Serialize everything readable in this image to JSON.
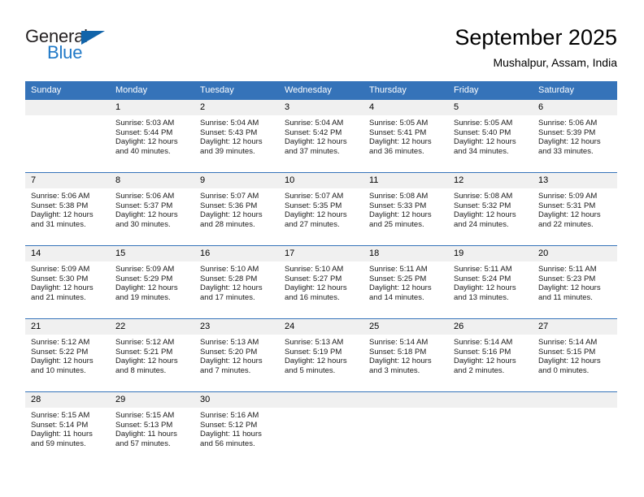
{
  "brand": {
    "name_part1": "General",
    "name_part2": "Blue"
  },
  "header": {
    "title": "September 2025",
    "location": "Mushalpur, Assam, India"
  },
  "colors": {
    "header_blue": "#3573b9",
    "logo_blue": "#2079c7",
    "daynum_band": "#f0f0f0"
  },
  "weekday_headers": [
    "Sunday",
    "Monday",
    "Tuesday",
    "Wednesday",
    "Thursday",
    "Friday",
    "Saturday"
  ],
  "weeks": [
    [
      {
        "day": "",
        "sunrise": "",
        "sunset": "",
        "daylight_line1": "",
        "daylight_line2": "",
        "empty": true
      },
      {
        "day": "1",
        "sunrise": "Sunrise: 5:03 AM",
        "sunset": "Sunset: 5:44 PM",
        "daylight_line1": "Daylight: 12 hours",
        "daylight_line2": "and 40 minutes."
      },
      {
        "day": "2",
        "sunrise": "Sunrise: 5:04 AM",
        "sunset": "Sunset: 5:43 PM",
        "daylight_line1": "Daylight: 12 hours",
        "daylight_line2": "and 39 minutes."
      },
      {
        "day": "3",
        "sunrise": "Sunrise: 5:04 AM",
        "sunset": "Sunset: 5:42 PM",
        "daylight_line1": "Daylight: 12 hours",
        "daylight_line2": "and 37 minutes."
      },
      {
        "day": "4",
        "sunrise": "Sunrise: 5:05 AM",
        "sunset": "Sunset: 5:41 PM",
        "daylight_line1": "Daylight: 12 hours",
        "daylight_line2": "and 36 minutes."
      },
      {
        "day": "5",
        "sunrise": "Sunrise: 5:05 AM",
        "sunset": "Sunset: 5:40 PM",
        "daylight_line1": "Daylight: 12 hours",
        "daylight_line2": "and 34 minutes."
      },
      {
        "day": "6",
        "sunrise": "Sunrise: 5:06 AM",
        "sunset": "Sunset: 5:39 PM",
        "daylight_line1": "Daylight: 12 hours",
        "daylight_line2": "and 33 minutes."
      }
    ],
    [
      {
        "day": "7",
        "sunrise": "Sunrise: 5:06 AM",
        "sunset": "Sunset: 5:38 PM",
        "daylight_line1": "Daylight: 12 hours",
        "daylight_line2": "and 31 minutes."
      },
      {
        "day": "8",
        "sunrise": "Sunrise: 5:06 AM",
        "sunset": "Sunset: 5:37 PM",
        "daylight_line1": "Daylight: 12 hours",
        "daylight_line2": "and 30 minutes."
      },
      {
        "day": "9",
        "sunrise": "Sunrise: 5:07 AM",
        "sunset": "Sunset: 5:36 PM",
        "daylight_line1": "Daylight: 12 hours",
        "daylight_line2": "and 28 minutes."
      },
      {
        "day": "10",
        "sunrise": "Sunrise: 5:07 AM",
        "sunset": "Sunset: 5:35 PM",
        "daylight_line1": "Daylight: 12 hours",
        "daylight_line2": "and 27 minutes."
      },
      {
        "day": "11",
        "sunrise": "Sunrise: 5:08 AM",
        "sunset": "Sunset: 5:33 PM",
        "daylight_line1": "Daylight: 12 hours",
        "daylight_line2": "and 25 minutes."
      },
      {
        "day": "12",
        "sunrise": "Sunrise: 5:08 AM",
        "sunset": "Sunset: 5:32 PM",
        "daylight_line1": "Daylight: 12 hours",
        "daylight_line2": "and 24 minutes."
      },
      {
        "day": "13",
        "sunrise": "Sunrise: 5:09 AM",
        "sunset": "Sunset: 5:31 PM",
        "daylight_line1": "Daylight: 12 hours",
        "daylight_line2": "and 22 minutes."
      }
    ],
    [
      {
        "day": "14",
        "sunrise": "Sunrise: 5:09 AM",
        "sunset": "Sunset: 5:30 PM",
        "daylight_line1": "Daylight: 12 hours",
        "daylight_line2": "and 21 minutes."
      },
      {
        "day": "15",
        "sunrise": "Sunrise: 5:09 AM",
        "sunset": "Sunset: 5:29 PM",
        "daylight_line1": "Daylight: 12 hours",
        "daylight_line2": "and 19 minutes."
      },
      {
        "day": "16",
        "sunrise": "Sunrise: 5:10 AM",
        "sunset": "Sunset: 5:28 PM",
        "daylight_line1": "Daylight: 12 hours",
        "daylight_line2": "and 17 minutes."
      },
      {
        "day": "17",
        "sunrise": "Sunrise: 5:10 AM",
        "sunset": "Sunset: 5:27 PM",
        "daylight_line1": "Daylight: 12 hours",
        "daylight_line2": "and 16 minutes."
      },
      {
        "day": "18",
        "sunrise": "Sunrise: 5:11 AM",
        "sunset": "Sunset: 5:25 PM",
        "daylight_line1": "Daylight: 12 hours",
        "daylight_line2": "and 14 minutes."
      },
      {
        "day": "19",
        "sunrise": "Sunrise: 5:11 AM",
        "sunset": "Sunset: 5:24 PM",
        "daylight_line1": "Daylight: 12 hours",
        "daylight_line2": "and 13 minutes."
      },
      {
        "day": "20",
        "sunrise": "Sunrise: 5:11 AM",
        "sunset": "Sunset: 5:23 PM",
        "daylight_line1": "Daylight: 12 hours",
        "daylight_line2": "and 11 minutes."
      }
    ],
    [
      {
        "day": "21",
        "sunrise": "Sunrise: 5:12 AM",
        "sunset": "Sunset: 5:22 PM",
        "daylight_line1": "Daylight: 12 hours",
        "daylight_line2": "and 10 minutes."
      },
      {
        "day": "22",
        "sunrise": "Sunrise: 5:12 AM",
        "sunset": "Sunset: 5:21 PM",
        "daylight_line1": "Daylight: 12 hours",
        "daylight_line2": "and 8 minutes."
      },
      {
        "day": "23",
        "sunrise": "Sunrise: 5:13 AM",
        "sunset": "Sunset: 5:20 PM",
        "daylight_line1": "Daylight: 12 hours",
        "daylight_line2": "and 7 minutes."
      },
      {
        "day": "24",
        "sunrise": "Sunrise: 5:13 AM",
        "sunset": "Sunset: 5:19 PM",
        "daylight_line1": "Daylight: 12 hours",
        "daylight_line2": "and 5 minutes."
      },
      {
        "day": "25",
        "sunrise": "Sunrise: 5:14 AM",
        "sunset": "Sunset: 5:18 PM",
        "daylight_line1": "Daylight: 12 hours",
        "daylight_line2": "and 3 minutes."
      },
      {
        "day": "26",
        "sunrise": "Sunrise: 5:14 AM",
        "sunset": "Sunset: 5:16 PM",
        "daylight_line1": "Daylight: 12 hours",
        "daylight_line2": "and 2 minutes."
      },
      {
        "day": "27",
        "sunrise": "Sunrise: 5:14 AM",
        "sunset": "Sunset: 5:15 PM",
        "daylight_line1": "Daylight: 12 hours",
        "daylight_line2": "and 0 minutes."
      }
    ],
    [
      {
        "day": "28",
        "sunrise": "Sunrise: 5:15 AM",
        "sunset": "Sunset: 5:14 PM",
        "daylight_line1": "Daylight: 11 hours",
        "daylight_line2": "and 59 minutes."
      },
      {
        "day": "29",
        "sunrise": "Sunrise: 5:15 AM",
        "sunset": "Sunset: 5:13 PM",
        "daylight_line1": "Daylight: 11 hours",
        "daylight_line2": "and 57 minutes."
      },
      {
        "day": "30",
        "sunrise": "Sunrise: 5:16 AM",
        "sunset": "Sunset: 5:12 PM",
        "daylight_line1": "Daylight: 11 hours",
        "daylight_line2": "and 56 minutes."
      },
      {
        "day": "",
        "sunrise": "",
        "sunset": "",
        "daylight_line1": "",
        "daylight_line2": "",
        "empty": true
      },
      {
        "day": "",
        "sunrise": "",
        "sunset": "",
        "daylight_line1": "",
        "daylight_line2": "",
        "empty": true
      },
      {
        "day": "",
        "sunrise": "",
        "sunset": "",
        "daylight_line1": "",
        "daylight_line2": "",
        "empty": true
      },
      {
        "day": "",
        "sunrise": "",
        "sunset": "",
        "daylight_line1": "",
        "daylight_line2": "",
        "empty": true
      }
    ]
  ]
}
